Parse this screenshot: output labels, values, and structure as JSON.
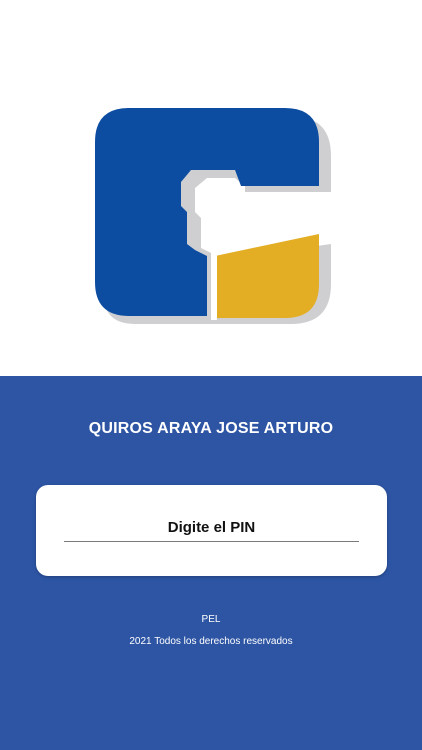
{
  "brand": {
    "logo_icon": "c-hammer-logo-icon",
    "colors": {
      "primary_blue": "#0d4da1",
      "accent_yellow": "#e3ad24",
      "shadow_gray": "#cfcfd2",
      "panel_blue": "#2d55a4"
    }
  },
  "user": {
    "name": "QUIROS ARAYA JOSE ARTURO"
  },
  "pin": {
    "placeholder": "Digite el PIN",
    "value": ""
  },
  "footer": {
    "code": "PEL",
    "copyright": "2021 Todos los derechos reservados"
  }
}
